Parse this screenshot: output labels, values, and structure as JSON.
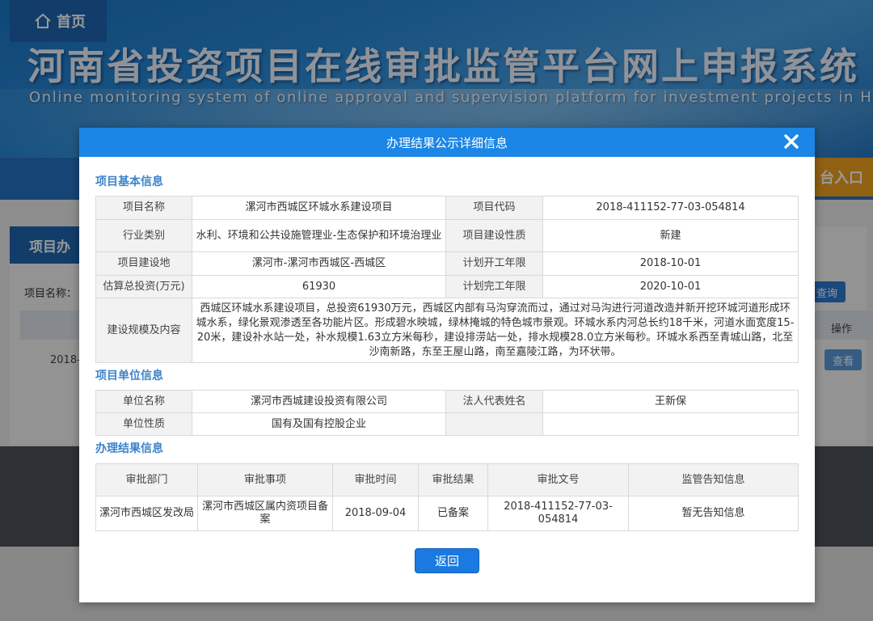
{
  "banner": {
    "title": "河南省投资项目在线审批监管平台网上申报系统",
    "subtitle": "Online monitoring system of online approval and supervision platform for investment projects in Henan"
  },
  "nav": {
    "home": "首页",
    "right": "台入口"
  },
  "background_panel": {
    "tab": "项目办",
    "field_label": "项目名称：",
    "search_button": "查询",
    "op_header": "操作",
    "row_date": "2018-",
    "view_button": "查看"
  },
  "modal": {
    "title": "办理结果公示详细信息",
    "back_label": "返回"
  },
  "basic": {
    "section_title": "项目基本信息",
    "labels": {
      "name": "项目名称",
      "code": "项目代码",
      "industry": "行业类别",
      "nature": "项目建设性质",
      "location": "项目建设地",
      "start": "计划开工年限",
      "investment": "估算总投资(万元)",
      "finish": "计划完工年限",
      "scale": "建设规模及内容"
    },
    "values": {
      "name": "漯河市西城区环城水系建设项目",
      "code": "2018-411152-77-03-054814",
      "industry": "水利、环境和公共设施管理业-生态保护和环境治理业",
      "nature": "新建",
      "location": "漯河市-漯河市西城区-西城区",
      "start": "2018-10-01",
      "investment": "61930",
      "finish": "2020-10-01",
      "scale": "西城区环城水系建设项目，总投资61930万元，西城区内部有马沟穿流而过，通过对马沟进行河道改造并新开挖环城河道形成环城水系，绿化景观渗透至各功能片区。形成碧水映城，绿林掩城的特色城市景观。环城水系内河总长约18千米，河道水面宽度15-20米，建设补水站一处，补水规模1.63立方米每秒，建设排涝站一处，排水规模28.0立方米每秒。环城水系西至青城山路，北至沙南新路，东至王屋山路，南至嘉陵江路，为环状带。"
    }
  },
  "unit": {
    "section_title": "项目单位信息",
    "labels": {
      "name": "单位名称",
      "legal": "法人代表姓名",
      "nature": "单位性质"
    },
    "values": {
      "name": "漯河市西城建设投资有限公司",
      "legal": "王新保",
      "nature": "国有及国有控股企业"
    }
  },
  "result": {
    "section_title": "办理结果信息",
    "headers": [
      "审批部门",
      "审批事项",
      "审批时间",
      "审批结果",
      "审批文号",
      "监管告知信息"
    ],
    "rows": [
      [
        "漯河市西城区发改局",
        "漯河市西城区属内资项目备案",
        "2018-09-04",
        "已备案",
        "2018-411152-77-03-054814",
        "暂无告知信息"
      ]
    ]
  },
  "colors": {
    "modal_header": "#1b86e6",
    "section_title": "#3c84cc",
    "label_bg": "#f2f2f2",
    "back_button": "#1a7ae2",
    "nav_blue": "#2572c4",
    "nav_orange": "#f0a020"
  },
  "icons": {
    "close": "close-icon",
    "home": "home-icon"
  }
}
